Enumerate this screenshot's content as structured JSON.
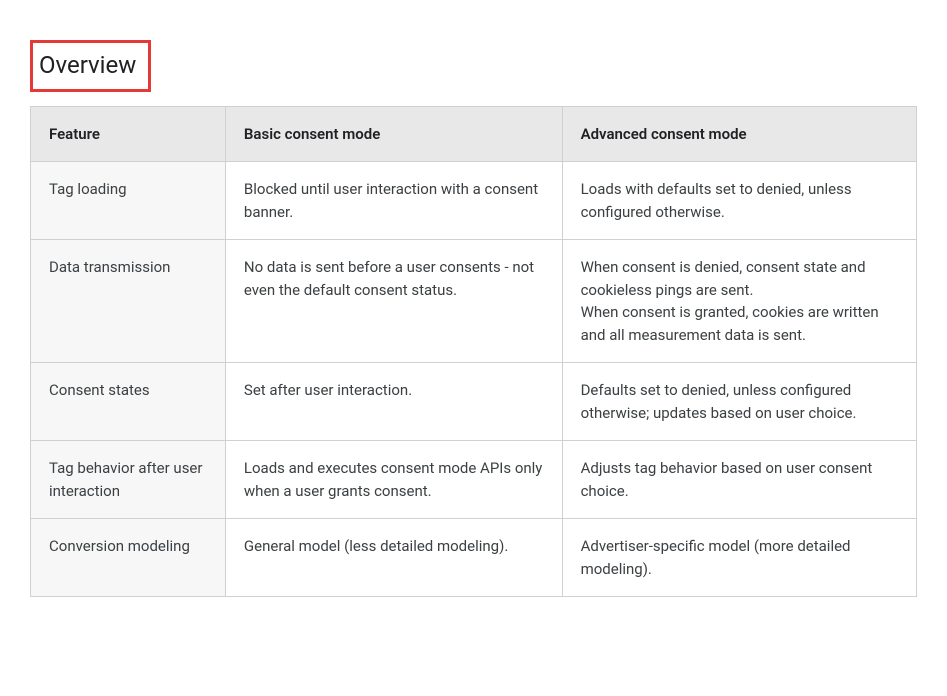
{
  "heading": "Overview",
  "table": {
    "headers": [
      "Feature",
      "Basic consent mode",
      "Advanced consent mode"
    ],
    "rows": [
      {
        "feature": "Tag loading",
        "basic": "Blocked until user interaction with a consent banner.",
        "advanced": "Loads with defaults set to denied, unless configured otherwise."
      },
      {
        "feature": "Data transmission",
        "basic": "No data is sent before a user consents -  not even the default consent status.",
        "advanced": "When consent is denied, consent state and cookieless pings are sent.\nWhen consent is granted, cookies are written and all measurement data is sent."
      },
      {
        "feature": "Consent states",
        "basic": "Set after user interaction.",
        "advanced": "Defaults set to denied, unless configured otherwise;  updates based on user choice."
      },
      {
        "feature": "Tag behavior after user interaction",
        "basic": "Loads and executes consent mode APIs only when a user grants consent.",
        "advanced": "Adjusts tag behavior based on user consent choice."
      },
      {
        "feature": "Conversion modeling",
        "basic": "General model (less detailed modeling).",
        "advanced": "Advertiser-specific model (more detailed modeling)."
      }
    ]
  }
}
